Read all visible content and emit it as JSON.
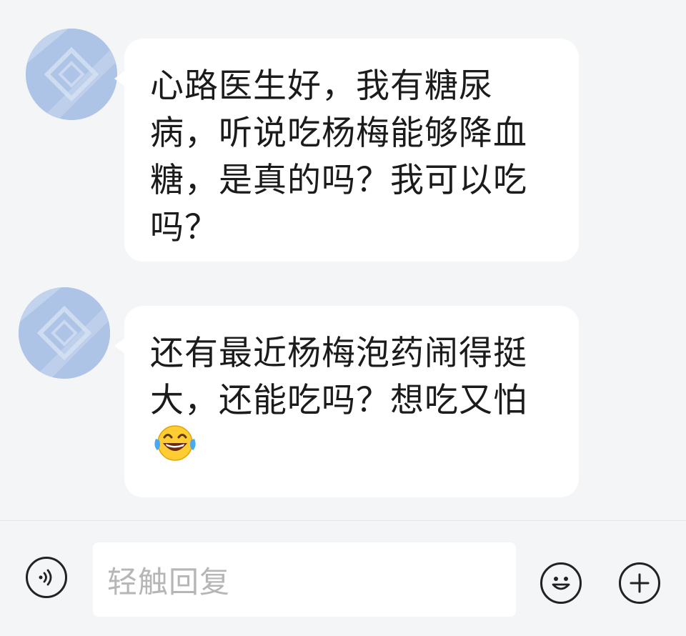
{
  "messages": [
    {
      "sender_avatar": "blurred-avatar",
      "text": "心路医生好，我有糖尿病，听说吃杨梅能够降血糖，是真的吗？我可以吃吗？"
    },
    {
      "sender_avatar": "blurred-avatar",
      "text": "还有最近杨梅泡药闹得挺大，还能吃吗？想吃又怕",
      "emoji": "face-with-tears-of-joy"
    }
  ],
  "composer": {
    "placeholder": "轻触回复",
    "voice_icon": "voice-icon",
    "emoji_icon": "smiley-icon",
    "add_icon": "plus-icon"
  },
  "colors": {
    "background": "#f4f5f6",
    "bubble": "#ffffff",
    "text": "#1b1b1b",
    "placeholder": "#b6b6b6",
    "avatar": "#aec4e6"
  }
}
